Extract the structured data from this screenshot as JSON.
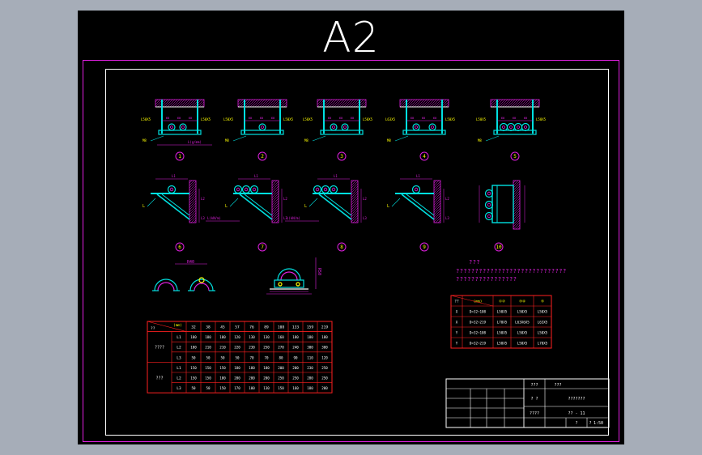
{
  "sheet_size": "A2",
  "views_top": [
    {
      "num": "1",
      "left_label": "L50X5",
      "right_label": "L50X5",
      "bolt_label": "M8",
      "dims": [
        "60",
        "60",
        "60"
      ],
      "extra": "L(g/mm)"
    },
    {
      "num": "2",
      "left_label": "L50X5",
      "right_label": "L50X5",
      "bolt_label": "M8",
      "dims": [
        "60",
        "60",
        "60"
      ]
    },
    {
      "num": "3",
      "left_label": "L50X5",
      "right_label": "L50X5",
      "bolt_label": "M8",
      "dims": [
        "60",
        "60",
        "60"
      ]
    },
    {
      "num": "4",
      "left_label": "L63X5",
      "right_label": "L50X5",
      "bolt_label": "M8",
      "dims": [
        "60",
        "60",
        "60"
      ]
    },
    {
      "num": "5",
      "left_label": "L50X5",
      "right_label": "L50X5",
      "bolt_label": "M8",
      "dims": [
        "60",
        "60",
        "60"
      ]
    }
  ],
  "views_mid": [
    {
      "num": "6",
      "label": "L"
    },
    {
      "num": "7",
      "label": "L"
    },
    {
      "num": "8",
      "label": "L"
    },
    {
      "num": "9",
      "label": "L"
    },
    {
      "num": "10",
      "label": ""
    }
  ],
  "mid_notes": [
    "L(kN/m)",
    "L(kN/m)"
  ],
  "detail_labels": {
    "saddle": "R50",
    "clamp": "R40"
  },
  "notes": {
    "title": "???",
    "lines": [
      "?????????????????????????????",
      "????????????????"
    ]
  },
  "right_table": {
    "header": [
      "??",
      "(mm)",
      "①②",
      "③④",
      "⑤"
    ],
    "rows": [
      [
        "X",
        "D=32~108",
        "L50X5",
        "L50X5",
        "L50X5"
      ],
      [
        "X",
        "D=32~219",
        "L70X5",
        "L63X6X5",
        "L63X5"
      ],
      [
        "Y",
        "D=32~108",
        "L50X5",
        "L50X5",
        "L50X5"
      ],
      [
        "Y",
        "D=32~219",
        "L50X5",
        "L50X5",
        "L70X5"
      ]
    ]
  },
  "left_table": {
    "corner": "(mm)",
    "corner_left": "??",
    "columns": [
      "32",
      "38",
      "45",
      "57",
      "76",
      "89",
      "108",
      "133",
      "159",
      "219"
    ],
    "groups": [
      {
        "name": "????",
        "rows": [
          {
            "label": "L1",
            "values": [
              "180",
              "180",
              "180",
              "120",
              "130",
              "130",
              "160",
              "180",
              "180",
              "180"
            ]
          },
          {
            "label": "L2",
            "values": [
              "180",
              "210",
              "210",
              "220",
              "230",
              "250",
              "270",
              "240",
              "300",
              "300"
            ]
          },
          {
            "label": "L3",
            "values": [
              "50",
              "50",
              "50",
              "50",
              "70",
              "70",
              "80",
              "90",
              "110",
              "120"
            ]
          }
        ]
      },
      {
        "name": "???",
        "rows": [
          {
            "label": "L1",
            "values": [
              "150",
              "150",
              "150",
              "180",
              "180",
              "180",
              "200",
              "200",
              "230",
              "250"
            ]
          },
          {
            "label": "L2",
            "values": [
              "150",
              "150",
              "180",
              "200",
              "200",
              "200",
              "250",
              "250",
              "280",
              "250"
            ]
          },
          {
            "label": "L3",
            "values": [
              "50",
              "50",
              "150",
              "170",
              "100",
              "130",
              "150",
              "160",
              "180",
              "200"
            ]
          }
        ]
      }
    ]
  },
  "title_block": {
    "r1_a": "???",
    "r1_b": "???",
    "r2_a": "?  ?",
    "r2_b": "???????",
    "r3_a": "????",
    "r3_b": "?? - 11",
    "r4_a": "?",
    "r4_b": "?",
    "r4_c": "1:50"
  },
  "colors": {
    "magenta": "#e020e0",
    "cyan": "#00e0e0",
    "red": "#ff2020",
    "white": "#ffffff",
    "yellow": "#ffff00",
    "green": "#20d020"
  }
}
